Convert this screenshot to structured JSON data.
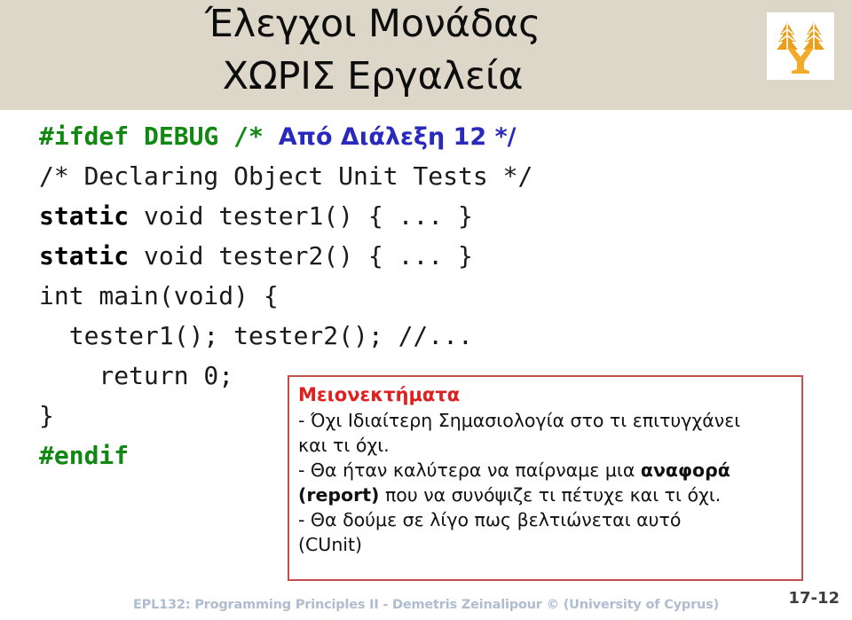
{
  "slide": {
    "title": "Έλεγχοι Μονάδας\nΧΩΡΙΣ Εργαλεία",
    "background_color": "#ffffff",
    "header_color": "#ddd7c9"
  },
  "logo": {
    "name": "university-of-cyprus-logo",
    "tree_color": "#e8a020",
    "trunk_color": "#f0b030",
    "background": "#ffffff"
  },
  "code": {
    "lines": [
      {
        "tokens": [
          {
            "text": "#ifdef DEBUG ",
            "style": "green"
          },
          {
            "text": "/* ",
            "style": "green"
          },
          {
            "text": "Από Διάλεξη 12 */",
            "style": "blue"
          }
        ]
      },
      {
        "tokens": [
          {
            "text": "/* Declaring Object Unit Tests */",
            "style": "plain"
          }
        ]
      },
      {
        "tokens": [
          {
            "text": "static",
            "style": "bold"
          },
          {
            "text": " void tester1() { ... }",
            "style": "plain"
          }
        ]
      },
      {
        "tokens": [
          {
            "text": "static",
            "style": "bold"
          },
          {
            "text": " void tester2() { ... }",
            "style": "plain"
          }
        ]
      },
      {
        "tokens": [
          {
            "text": "int main(void) {",
            "style": "plain"
          }
        ]
      },
      {
        "tokens": [
          {
            "text": "  tester1(); tester2(); //...",
            "style": "plain"
          }
        ]
      },
      {
        "tokens": [
          {
            "text": "    return 0;",
            "style": "plain"
          }
        ]
      },
      {
        "tokens": [
          {
            "text": "}",
            "style": "plain"
          }
        ]
      },
      {
        "tokens": [
          {
            "text": "#endif",
            "style": "green"
          }
        ]
      }
    ],
    "colors": {
      "preprocessor": "#118811",
      "greek_comment": "#2929bd",
      "plain": "#1a1a1a"
    }
  },
  "callout": {
    "title": "Μειονεκτήματα",
    "title_color": "#e02020",
    "border_color": "#c0504d",
    "lines": [
      {
        "parts": [
          {
            "text": "- Όχι Ιδιαίτερη Σημασιολογία στο τι επιτυγχάνει",
            "bold": false
          }
        ]
      },
      {
        "parts": [
          {
            "text": "και τι όχι.",
            "bold": false
          }
        ]
      },
      {
        "parts": [
          {
            "text": "- Θα ήταν καλύτερα να παίρναμε μια ",
            "bold": false
          },
          {
            "text": "αναφορά",
            "bold": true
          }
        ]
      },
      {
        "parts": [
          {
            "text": "(report)",
            "bold": true
          },
          {
            "text": " που να συνόψιζε τι πέτυχε και τι όχι.",
            "bold": false
          }
        ]
      },
      {
        "parts": [
          {
            "text": "- Θα δούμε σε λίγο πως βελτιώνεται αυτό",
            "bold": false
          }
        ]
      },
      {
        "parts": [
          {
            "text": "(CUnit)",
            "bold": false
          }
        ]
      }
    ]
  },
  "footer": {
    "course_line": "EPL132: Programming Principles II - Demetris Zeinalipour © (University of Cyprus)",
    "page_number": "17-12",
    "course_line_color": "#aebdd0"
  }
}
